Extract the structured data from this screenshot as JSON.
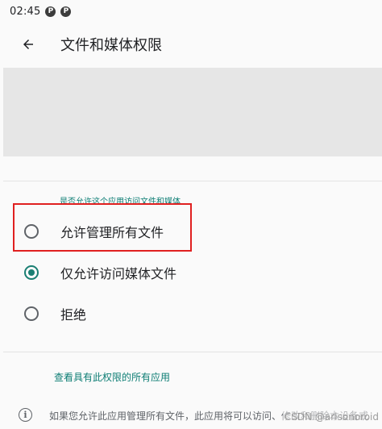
{
  "status_bar": {
    "time": "02:45",
    "icons": [
      "app-notification-icon",
      "app-notification-icon"
    ]
  },
  "app_bar": {
    "back_icon": "arrow-back-icon",
    "title": "文件和媒体权限"
  },
  "section": {
    "label": "是否允许这个应用访问文件和媒体"
  },
  "options": [
    {
      "label": "允许管理所有文件",
      "checked": false,
      "highlighted": true
    },
    {
      "label": "仅允许访问媒体文件",
      "checked": true,
      "highlighted": false
    },
    {
      "label": "拒绝",
      "checked": false,
      "highlighted": false
    }
  ],
  "link": {
    "label": "查看具有此权限的所有应用"
  },
  "info": {
    "icon": "info-icon",
    "text": "如果您允许此应用管理所有文件，此应用将可以访问、修改和删除本设备或"
  },
  "watermark": "CSDN @arisonoroid",
  "colors": {
    "accent": "#1a7f73",
    "link": "#0d7d74",
    "highlight": "#e02020",
    "header_block": "#e6e6e6"
  }
}
